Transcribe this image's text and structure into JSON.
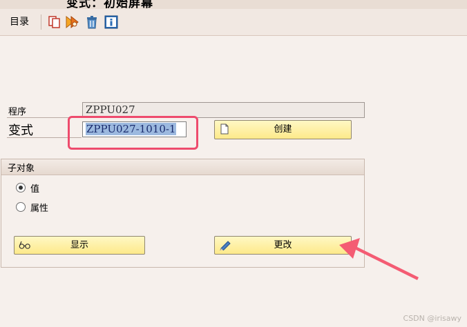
{
  "window": {
    "title": "变式：初始屏幕"
  },
  "toolbar": {
    "menu_label": "目录",
    "icons": [
      "copy-icon",
      "execute-icon",
      "delete-icon",
      "info-icon"
    ]
  },
  "fields": {
    "program_label": "程序",
    "program_value": "ZPPU027",
    "variant_label": "变式",
    "variant_value": "ZPPU027-1010-1"
  },
  "buttons": {
    "create": "创建",
    "display": "显示",
    "change": "更改"
  },
  "subobjects": {
    "title": "子对象",
    "options": [
      {
        "label": "值",
        "selected": true
      },
      {
        "label": "属性",
        "selected": false
      }
    ]
  },
  "watermark": "CSDN @irisawy",
  "colors": {
    "highlight": "#ee4b6d",
    "button": "#fde98a",
    "selection": "#9cb9df"
  }
}
